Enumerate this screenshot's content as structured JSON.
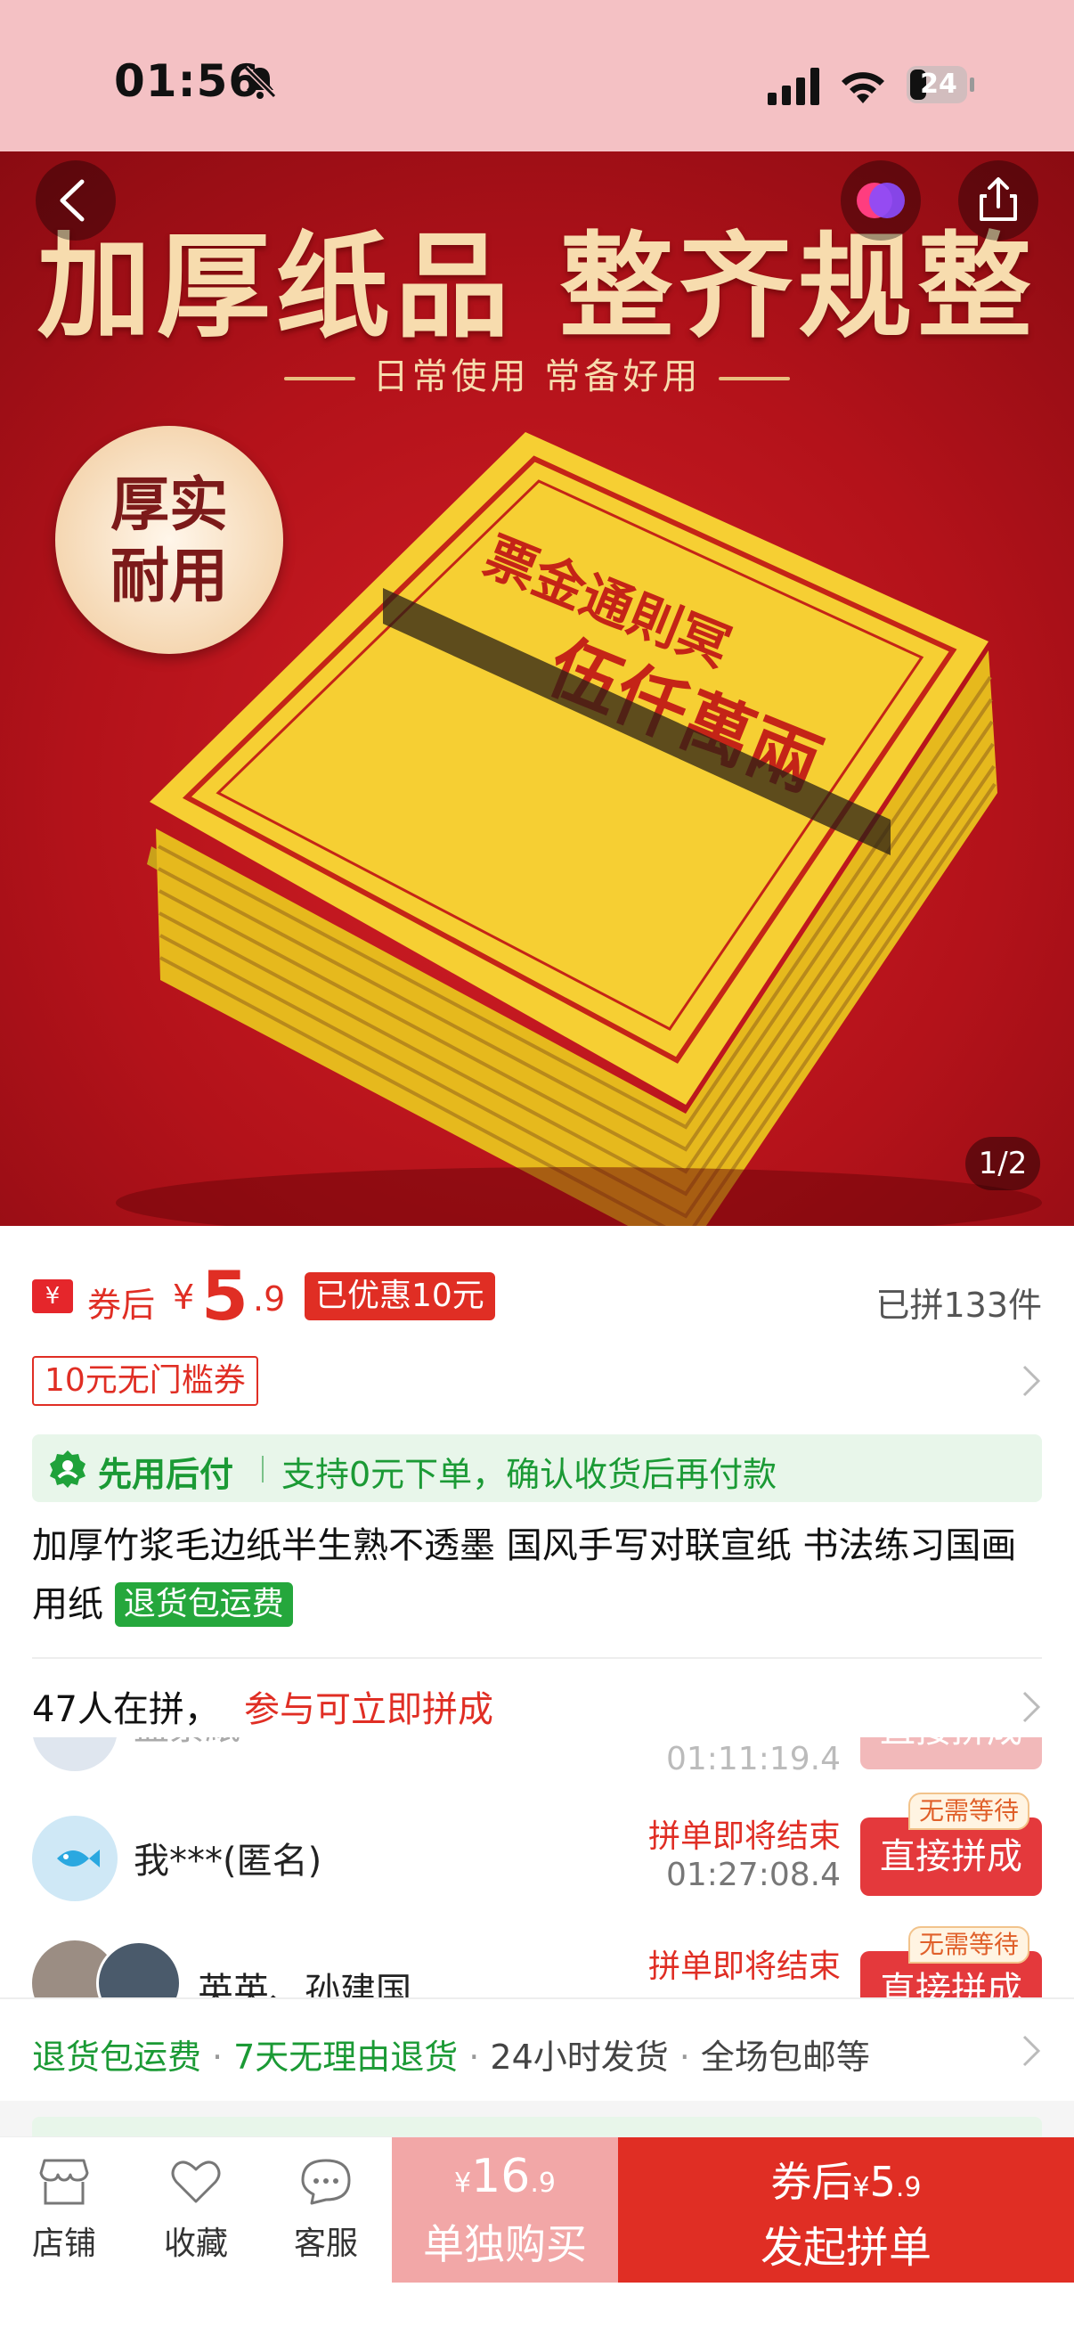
{
  "status_bar": {
    "time": "01:56",
    "battery": "24"
  },
  "hero": {
    "title": "加厚纸品 整齐规整",
    "subtitle": "日常使用 常备好用",
    "seal_text": "厚实耐用",
    "pager": "1/2"
  },
  "price": {
    "after_coupon_label": "券后",
    "yen": "¥",
    "integer": "5",
    "decimal": ".9",
    "discount_badge": "已优惠10元",
    "sold": "已拼133件"
  },
  "coupon": {
    "label": "10元无门槛券"
  },
  "bnpl": {
    "title": "先用后付",
    "desc": "支持0元下单，确认收货后再付款"
  },
  "product": {
    "title": "加厚竹浆毛边纸半生熟不透墨 国风手写对联宣纸 书法练习国画用纸",
    "return_tag": "退货包运费"
  },
  "group": {
    "count_text": "47人在拼，",
    "cta": "参与可立即拼成",
    "rows": [
      {
        "name": "盖紊紙",
        "ending": "",
        "timer": "01:11:19.4",
        "button": "直接拼成",
        "nowait": ""
      },
      {
        "name": "我***(匿名)",
        "ending": "拼单即将结束",
        "timer": "01:27:08.4",
        "button": "直接拼成",
        "nowait": "无需等待"
      },
      {
        "name": "英英、孙建国",
        "ending": "拼单即将结束",
        "timer": "",
        "button": "直接拼成",
        "nowait": "无需等待"
      }
    ]
  },
  "service": {
    "items": [
      "退货包运费",
      "7天无理由退货",
      "24小时发货",
      "全场包邮等"
    ]
  },
  "bottom_bar": {
    "store": "店铺",
    "favorite": "收藏",
    "support": "客服",
    "single_yen": "¥",
    "single_price_int": "16",
    "single_price_dec": ".9",
    "single_label": "单独购买",
    "group_prefix": "券后",
    "group_yen": "¥",
    "group_price_int": "5",
    "group_price_dec": ".9",
    "group_label": "发起拼单"
  },
  "colors": {
    "accent": "#e02e24",
    "green": "#1b9a35",
    "status_bg": "#f4c1c4"
  }
}
